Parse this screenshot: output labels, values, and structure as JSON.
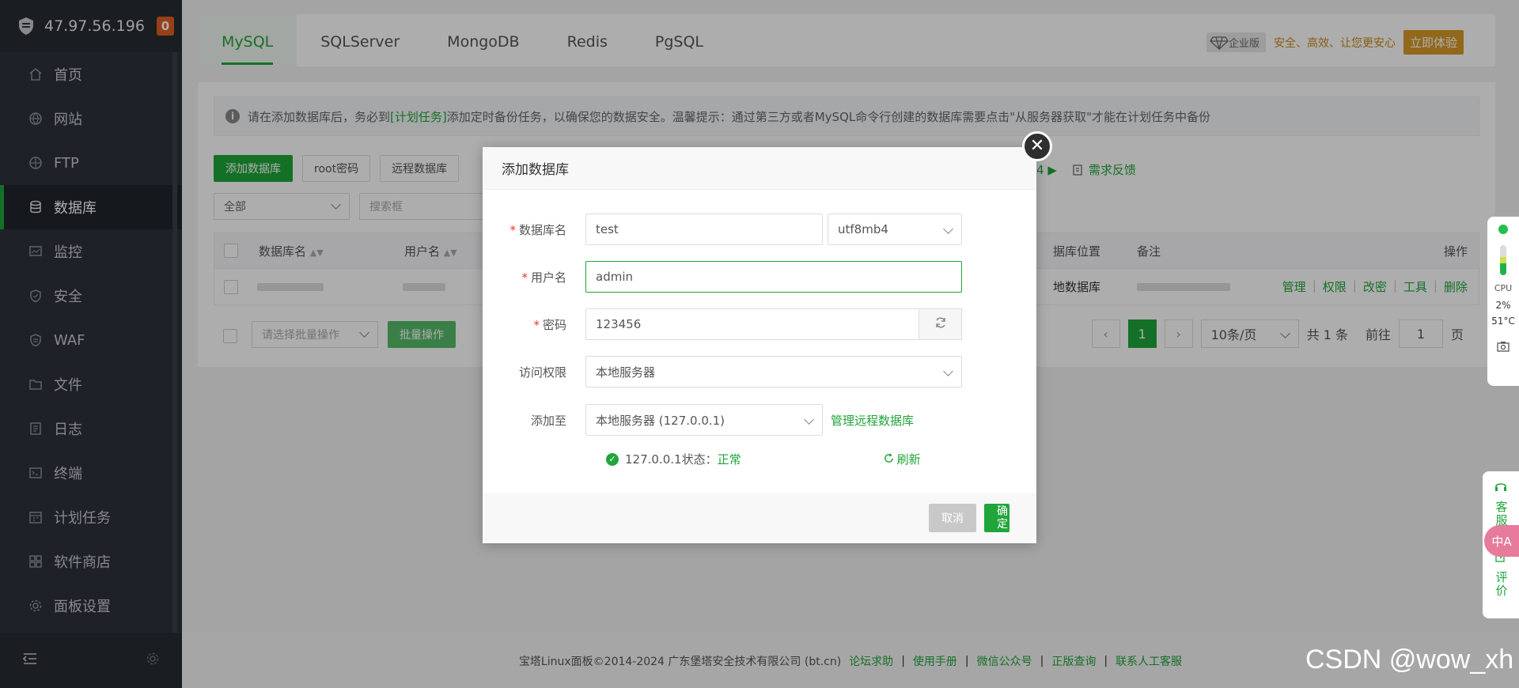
{
  "sidebar": {
    "ip": "47.97.56.196",
    "badge": "0",
    "items": [
      {
        "label": "首页",
        "icon": "home-icon"
      },
      {
        "label": "网站",
        "icon": "globe-icon"
      },
      {
        "label": "FTP",
        "icon": "ftp-icon"
      },
      {
        "label": "数据库",
        "icon": "database-icon"
      },
      {
        "label": "监控",
        "icon": "monitor-icon"
      },
      {
        "label": "安全",
        "icon": "shield-icon"
      },
      {
        "label": "WAF",
        "icon": "waf-icon"
      },
      {
        "label": "文件",
        "icon": "folder-icon"
      },
      {
        "label": "日志",
        "icon": "log-icon"
      },
      {
        "label": "终端",
        "icon": "terminal-icon"
      },
      {
        "label": "计划任务",
        "icon": "calendar-icon"
      },
      {
        "label": "软件商店",
        "icon": "apps-icon"
      },
      {
        "label": "面板设置",
        "icon": "gear-icon"
      }
    ],
    "active_index": 3
  },
  "tabs": [
    "MySQL",
    "SQLServer",
    "MongoDB",
    "Redis",
    "PgSQL"
  ],
  "promo": {
    "edition": "企业版",
    "slogan": "安全、高效、让您更安心",
    "cta": "立即体验"
  },
  "tip": {
    "before": "请在添加数据库后，务必到",
    "link": "[计划任务]",
    "after": "添加定时备份任务，以确保您的数据安全。温馨提示：通过第三方或者MySQL命令行创建的数据库需要点击\"从服务器获取\"才能在计划任务中备份"
  },
  "toolbar": {
    "add_db": "添加数据库",
    "root_pwd": "root密码",
    "remote_db": "远程数据库",
    "version_tail": "4",
    "feedback": "需求反馈"
  },
  "filter": {
    "category": "全部",
    "search_placeholder": "搜索框"
  },
  "table": {
    "headers": [
      "数据库名",
      "用户名",
      "据库位置",
      "备注",
      "操作"
    ],
    "row": {
      "location": "地数据库",
      "ops": [
        "管理",
        "权限",
        "改密",
        "工具",
        "删除"
      ]
    }
  },
  "batch": {
    "placeholder": "请选择批量操作",
    "button": "批量操作"
  },
  "pager": {
    "current": "1",
    "per_page": "10条/页",
    "total": "共 1 条",
    "goto_label": "前往",
    "goto_value": "1",
    "page_suffix": "页"
  },
  "footer": {
    "copyright": "宝塔Linux面板©2014-2024 广东堡塔安全技术有限公司 (bt.cn)",
    "links": [
      "论坛求助",
      "使用手册",
      "微信公众号",
      "正版查询",
      "联系人工客服"
    ]
  },
  "monitor": {
    "cpu_label": "CPU",
    "cpu_value": "2%",
    "temp": "51°C"
  },
  "service": {
    "kefu": "客服",
    "pingjia": "评价",
    "translate": "中A"
  },
  "watermark": "CSDN @wow_xh",
  "modal": {
    "title": "添加数据库",
    "db_name_label": "数据库名",
    "db_name_value": "test",
    "charset": "utf8mb4",
    "user_label": "用户名",
    "user_value": "admin",
    "pwd_label": "密码",
    "pwd_value": "123456",
    "access_label": "访问权限",
    "access_value": "本地服务器",
    "add_to_label": "添加至",
    "add_to_value": "本地服务器 (127.0.0.1)",
    "manage_remote": "管理远程数据库",
    "status_prefix": "127.0.0.1状态：",
    "status_value": "正常",
    "refresh": "刷新",
    "cancel": "取消",
    "confirm": "确定"
  }
}
